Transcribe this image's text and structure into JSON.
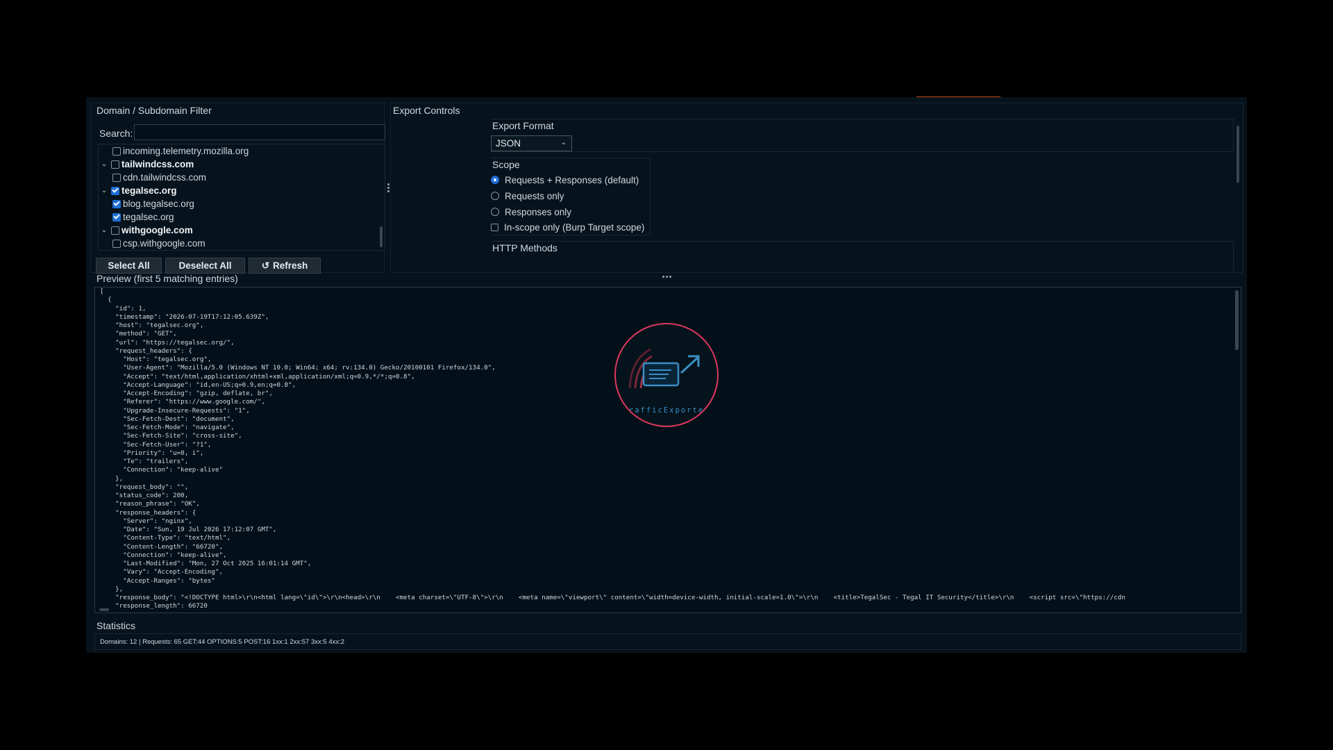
{
  "domain_filter": {
    "title": "Domain / Subdomain Filter",
    "search_label": "Search:",
    "search_value": "",
    "tree": [
      {
        "label": "incoming.telemetry.mozilla.org",
        "level": "child",
        "checked": false
      },
      {
        "label": "tailwindcss.com",
        "level": "parent",
        "checked": false
      },
      {
        "label": "cdn.tailwindcss.com",
        "level": "child",
        "checked": false
      },
      {
        "label": "tegalsec.org",
        "level": "parent",
        "checked": true
      },
      {
        "label": "blog.tegalsec.org",
        "level": "child",
        "checked": true
      },
      {
        "label": "tegalsec.org",
        "level": "child",
        "checked": true
      },
      {
        "label": "withgoogle.com",
        "level": "parent",
        "checked": false
      },
      {
        "label": "csp.withgoogle.com",
        "level": "child",
        "checked": false
      }
    ],
    "buttons": {
      "select_all": "Select All",
      "deselect_all": "Deselect All",
      "refresh": "Refresh",
      "refresh_icon": "↺"
    }
  },
  "export_controls": {
    "title": "Export Controls",
    "format_label": "Export Format",
    "format_value": "JSON",
    "scope_label": "Scope",
    "scope_options": [
      {
        "label": "Requests + Responses (default)",
        "selected": true
      },
      {
        "label": "Requests only",
        "selected": false
      },
      {
        "label": "Responses only",
        "selected": false
      }
    ],
    "in_scope_label": "In-scope only (Burp Target scope)",
    "in_scope_checked": false,
    "http_methods_label": "HTTP Methods"
  },
  "preview": {
    "title": "Preview (first 5 matching entries)",
    "lines": [
      "[",
      "  {",
      "    \"id\": 1,",
      "    \"timestamp\": \"2026-07-19T17:12:05.639Z\",",
      "    \"host\": \"tegalsec.org\",",
      "    \"method\": \"GET\",",
      "    \"url\": \"https://tegalsec.org/\",",
      "    \"request_headers\": {",
      "      \"Host\": \"tegalsec.org\",",
      "      \"User-Agent\": \"Mozilla/5.0 (Windows NT 10.0; Win64; x64; rv:134.0) Gecko/20100101 Firefox/134.0\",",
      "      \"Accept\": \"text/html,application/xhtml+xml,application/xml;q=0.9,*/*;q=0.8\",",
      "      \"Accept-Language\": \"id,en-US;q=0.9,en;q=0.8\",",
      "      \"Accept-Encoding\": \"gzip, deflate, br\",",
      "      \"Referer\": \"https://www.google.com/\",",
      "      \"Upgrade-Insecure-Requests\": \"1\",",
      "      \"Sec-Fetch-Dest\": \"document\",",
      "      \"Sec-Fetch-Mode\": \"navigate\",",
      "      \"Sec-Fetch-Site\": \"cross-site\",",
      "      \"Sec-Fetch-User\": \"?1\",",
      "      \"Priority\": \"u=0, i\",",
      "      \"Te\": \"trailers\",",
      "      \"Connection\": \"keep-alive\"",
      "    },",
      "    \"request_body\": \"\",",
      "    \"status_code\": 200,",
      "    \"reason_phrase\": \"OK\",",
      "    \"response_headers\": {",
      "      \"Server\": \"nginx\",",
      "      \"Date\": \"Sun, 19 Jul 2026 17:12:07 GMT\",",
      "      \"Content-Type\": \"text/html\",",
      "      \"Content-Length\": \"66720\",",
      "      \"Connection\": \"keep-alive\",",
      "      \"Last-Modified\": \"Mon, 27 Oct 2025 16:01:14 GMT\",",
      "      \"Vary\": \"Accept-Encoding\",",
      "      \"Accept-Ranges\": \"bytes\"",
      "    },",
      "    \"response_body\": \"<!DOCTYPE html>\\r\\n<html lang=\\\"id\\\">\\r\\n<head>\\r\\n    <meta charset=\\\"UTF-8\\\">\\r\\n    <meta name=\\\"viewport\\\" content=\\\"width=device-width, initial-scale=1.0\\\">\\r\\n    <title>TegalSec - Tegal IT Security</title>\\r\\n    <script src=\\\"https://cdn",
      "    \"response_length\": 66720"
    ],
    "logo_text": "TrafficExporter"
  },
  "statistics": {
    "title": "Statistics",
    "text": "Domains: 12  |  Requests: 65   GET:44   OPTIONS:5   POST:16   1xx:1   2xx:57   3xx:5   4xx:2"
  },
  "colors": {
    "background": "#06131d",
    "accent": "#c9541e",
    "checkbox_checked": "#1f6fd6",
    "logo_ring": "#e0385f",
    "logo_blue": "#3a8fc4"
  }
}
